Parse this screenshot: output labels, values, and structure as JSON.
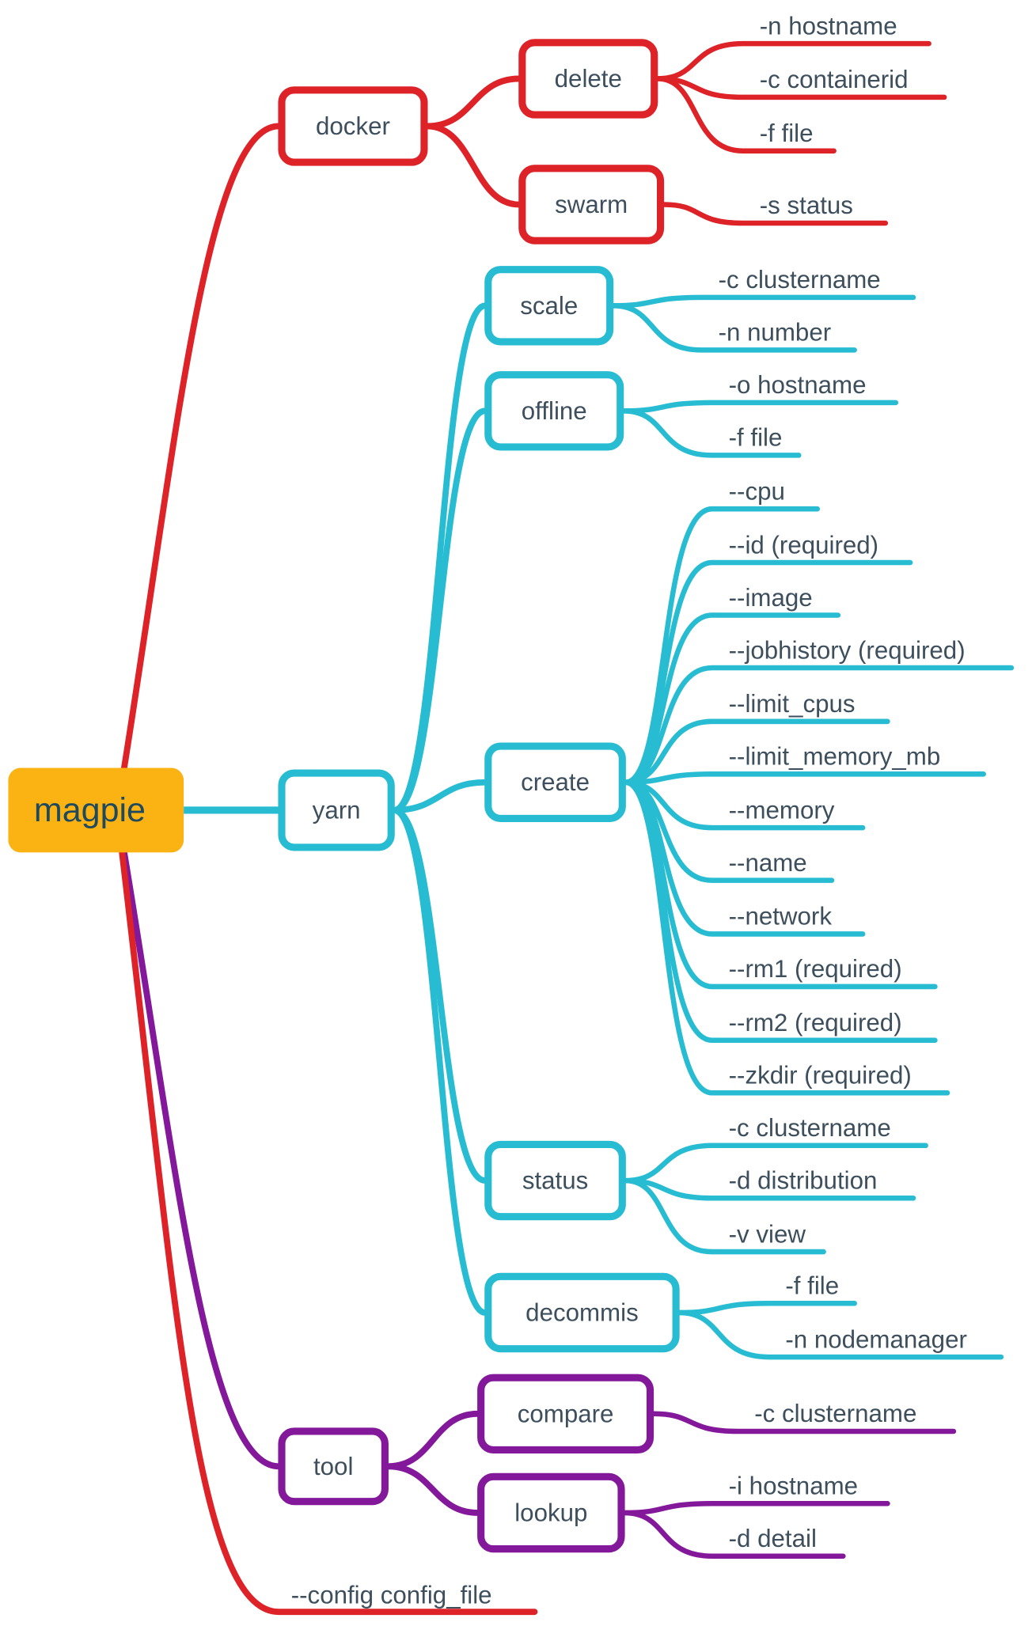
{
  "colors": {
    "root": "#fbb313",
    "docker": "#dd2228",
    "yarn": "#27bcd2",
    "tool": "#84189a",
    "config": "#dd2228",
    "text": "#3d4f5c"
  },
  "root": {
    "label": "magpie"
  },
  "branches": [
    {
      "id": "docker",
      "label": "docker",
      "color": "docker",
      "children": [
        {
          "id": "delete",
          "label": "delete",
          "options": [
            "-n hostname",
            "-c containerid",
            "-f file"
          ]
        },
        {
          "id": "swarm",
          "label": "swarm",
          "options": [
            "-s status"
          ]
        }
      ]
    },
    {
      "id": "yarn",
      "label": "yarn",
      "color": "yarn",
      "children": [
        {
          "id": "scale",
          "label": "scale",
          "options": [
            "-c clustername",
            "-n number"
          ]
        },
        {
          "id": "offline",
          "label": "offline",
          "options": [
            "-o hostname",
            "-f file"
          ]
        },
        {
          "id": "create",
          "label": "create",
          "options": [
            "--cpu",
            "--id (required)",
            "--image",
            "--jobhistory (required)",
            "--limit_cpus",
            "--limit_memory_mb",
            "--memory",
            "--name",
            "--network",
            "--rm1 (required)",
            "--rm2 (required)",
            "--zkdir (required)"
          ]
        },
        {
          "id": "status",
          "label": "status",
          "options": [
            "-c clustername",
            "-d distribution",
            "-v view"
          ]
        },
        {
          "id": "decommis",
          "label": "decommis",
          "options": [
            "-f file",
            "-n nodemanager"
          ]
        }
      ]
    },
    {
      "id": "tool",
      "label": "tool",
      "color": "tool",
      "children": [
        {
          "id": "compare",
          "label": "compare",
          "options": [
            "-c clustername"
          ]
        },
        {
          "id": "lookup",
          "label": "lookup",
          "options": [
            "-i hostname",
            "-d detail"
          ]
        }
      ]
    }
  ],
  "root_option": {
    "label": "--config config_file",
    "color": "config"
  }
}
